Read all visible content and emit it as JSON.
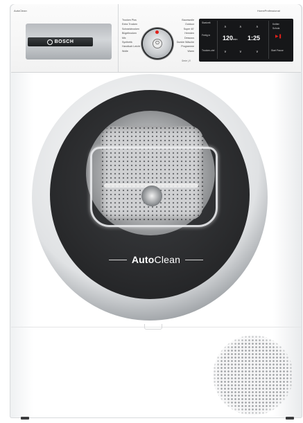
{
  "product": {
    "brand": "BOSCH",
    "badge_top_left": "AutoClean",
    "series_top_right": "HomeProfessional",
    "series_label": "Serie | 8",
    "door_label_bold": "Auto",
    "door_label_thin": "Clean"
  },
  "programs": {
    "left": [
      "Trocken Plus",
      "Extra Trocken",
      "Schranktrocken",
      "Bügeltrocken",
      "Mix",
      "Synthetik",
      "Handtuch Leicht",
      "Wolle"
    ],
    "right": [
      "Baumwolle",
      "Outdoor",
      "Super 40'",
      "Hemden",
      "Dessous",
      "Dunkle Wäsche",
      "Programme",
      "Warm"
    ]
  },
  "display": {
    "left_col": [
      "Startzeit",
      "Fertig in",
      "Trocken-ziel"
    ],
    "time_value": "120",
    "time_unit": "min",
    "end_value": "1:25",
    "right_col": [
      "Knitter",
      "Schutz",
      "Signal"
    ],
    "start_label": "Start Pause"
  },
  "colors": {
    "accent_red": "#e0211b",
    "display_bg": "#161719",
    "drawer_handle": "#1c1e20"
  }
}
